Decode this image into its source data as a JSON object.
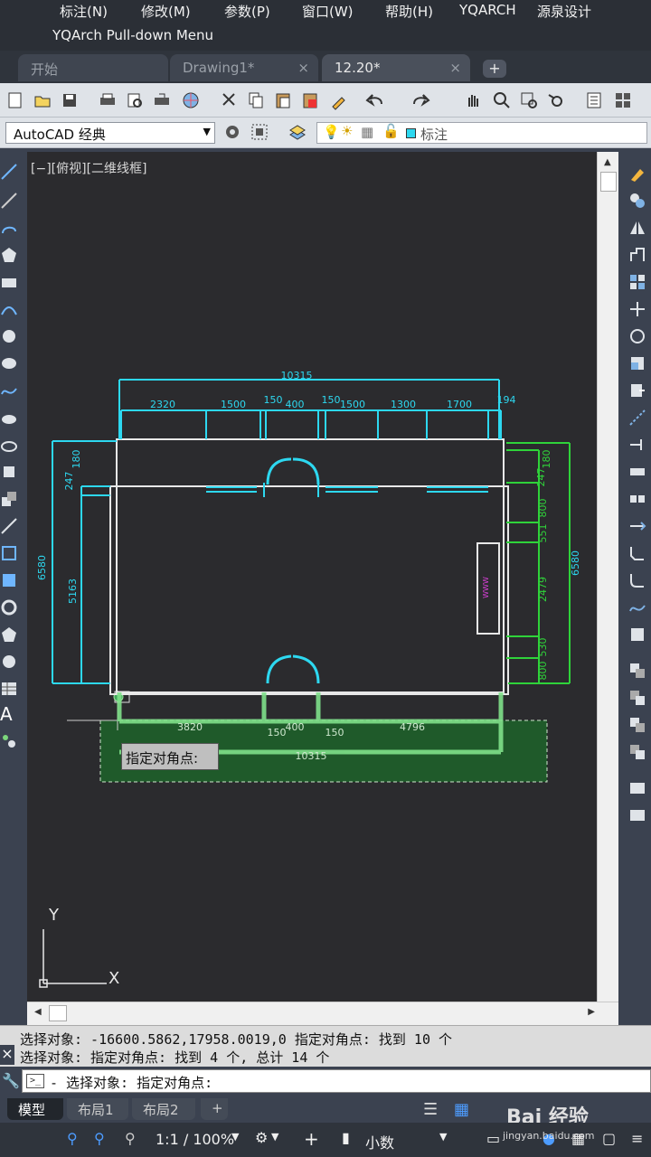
{
  "menu": {
    "items": [
      "标注(N)",
      "修改(M)",
      "参数(P)",
      "窗口(W)",
      "帮助(H)",
      "YQARCH",
      "源泉设计"
    ],
    "row2_label": "YQArch Pull-down Menu"
  },
  "tabs": [
    {
      "label": "开始",
      "close": ""
    },
    {
      "label": "Drawing1*",
      "close": "×"
    },
    {
      "label": "12.20*",
      "close": "×"
    }
  ],
  "tab_add": "+",
  "workspace": {
    "value": "AutoCAD 经典"
  },
  "layer": {
    "name": "标注",
    "color": "#2dd8f0"
  },
  "viewport_label": "[−][俯视][二维线框]",
  "drawing": {
    "overall_width": "10315",
    "top_dims": [
      "2320",
      "1500",
      "150",
      "400",
      "150",
      "1500",
      "1300",
      "1700",
      "194"
    ],
    "left_outer": "6580",
    "left_inner": "5163",
    "left_small_1": "247",
    "left_small_2": "180",
    "right_outer": "6580",
    "right_dims": [
      "180",
      "247",
      "800",
      "551",
      "2479",
      "530",
      "800"
    ],
    "bottom_dims": [
      "3820",
      "150",
      "400",
      "150",
      "4796"
    ],
    "bottom_overall": "10315",
    "fixture_text": "WWW"
  },
  "tooltip": "指定对角点:",
  "ucs": {
    "y": "Y",
    "x": "X"
  },
  "command": {
    "history": [
      "选择对象: -16600.5862,17958.0019,0 指定对角点: 找到 10 个",
      "选择对象: 指定对角点: 找到 4 个, 总计 14 个"
    ],
    "current": "- 选择对象: 指定对角点:",
    "close_icon": "×"
  },
  "layout_tabs": [
    "模型",
    "布局1",
    "布局2",
    "+"
  ],
  "status": {
    "scale": "1:1 / 100%",
    "units": "小数"
  },
  "watermark": {
    "main": "Bai 经验",
    "sub": "jingyan.baidu.com"
  }
}
